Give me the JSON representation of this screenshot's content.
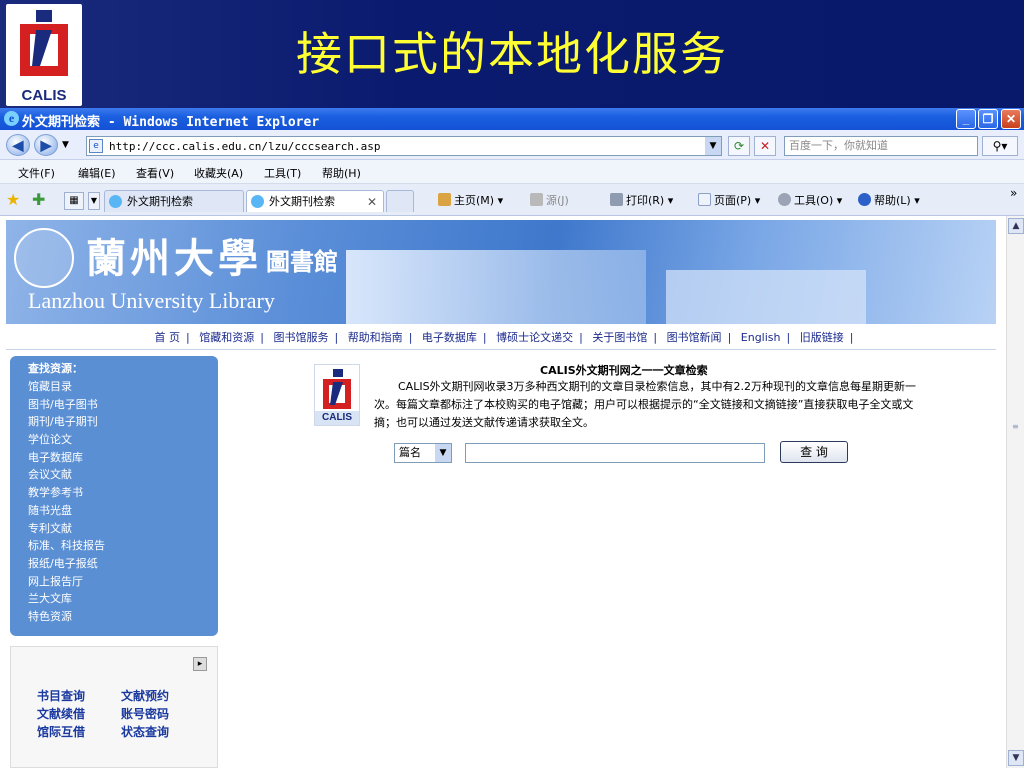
{
  "slide": {
    "title": "接口式的本地化服务",
    "logo_text": "CALIS"
  },
  "browser": {
    "window_title": "外文期刊检索 - Windows Internet Explorer",
    "url": "http://ccc.calis.edu.cn/lzu/cccsearch.asp",
    "search_placeholder": "百度一下，你就知道",
    "menu": [
      "文件(F)",
      "编辑(E)",
      "查看(V)",
      "收藏夹(A)",
      "工具(T)",
      "帮助(H)"
    ],
    "tabs": [
      {
        "label": "外文期刊检索",
        "active": false
      },
      {
        "label": "外文期刊检索",
        "active": true
      }
    ],
    "tools": [
      "主页(M)",
      "源(J)",
      "打印(R)",
      "页面(P)",
      "工具(O)",
      "帮助(L)"
    ],
    "more_glyph": "»"
  },
  "page": {
    "banner": {
      "cn_name": "蘭州大學",
      "cn_lib": "圖書館",
      "en_name": "Lanzhou University Library"
    },
    "nav": [
      "首 页",
      "馆藏和资源",
      "图书馆服务",
      "帮助和指南",
      "电子数据库",
      "博硕士论文递交",
      "关于图书馆",
      "图书馆新闻",
      "English",
      "旧版链接"
    ],
    "sidebar": {
      "header": "查找资源：",
      "items": [
        "馆藏目录",
        "图书/电子图书",
        "期刊/电子期刊",
        "学位论文",
        "电子数据库",
        "会议文献",
        "教学参考书",
        "随书光盘",
        "专利文献",
        "标准、科技报告",
        "报纸/电子报纸",
        "网上报告厅",
        "兰大文库",
        "特色资源"
      ]
    },
    "services": [
      "书目查询",
      "文献预约",
      "文献续借",
      "账号密码",
      "馆际互借",
      "状态查询"
    ],
    "calis_logo_text": "CALIS",
    "article": {
      "title": "CALIS外文期刊网之一一文章检索",
      "description": "CALIS外文期刊网收录3万多种西文期刊的文章目录检索信息，其中有2.2万种现刊的文章信息每星期更新一次。每篇文章都标注了本校购买的电子馆藏；用户可以根据提示的“全文链接和文摘链接”直接获取电子全文或文摘；也可以通过发送文献传递请求获取全文。"
    },
    "search": {
      "field_selected": "篇名",
      "query_value": "",
      "button_label": "查 询"
    }
  },
  "colors": {
    "slide_bg": "#0a1a6e",
    "title_yellow": "#ffff33",
    "sidebar_blue": "#5b8fd4",
    "ie_titlebar": "#1a5fe0"
  }
}
